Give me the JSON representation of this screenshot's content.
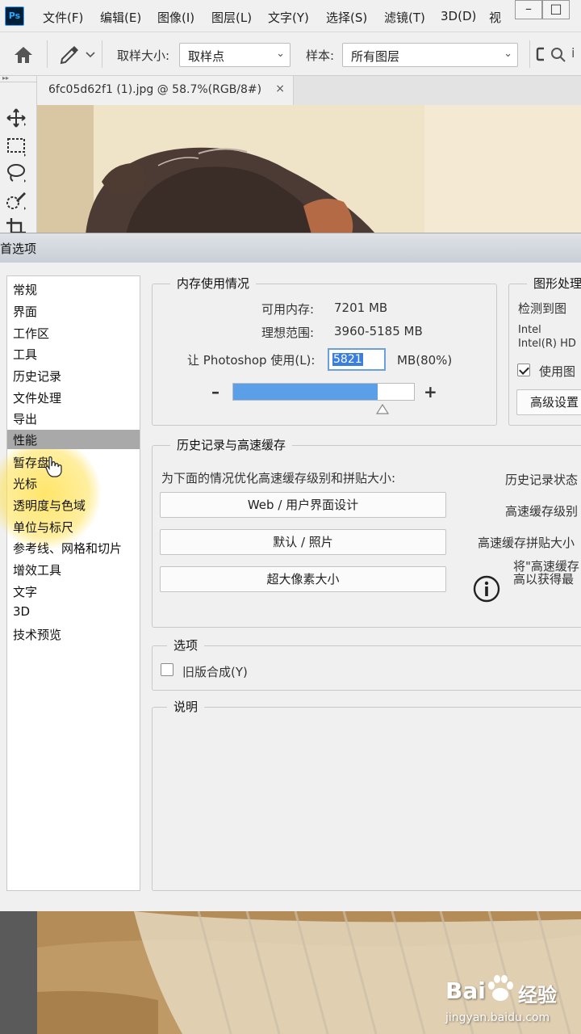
{
  "app": {
    "logo_text": "Ps"
  },
  "menu": [
    "文件(F)",
    "编辑(E)",
    "图像(I)",
    "图层(L)",
    "文字(Y)",
    "选择(S)",
    "滤镜(T)",
    "3D(D)",
    "视"
  ],
  "window_controls": {
    "minimize": "–",
    "maximize": "□"
  },
  "options_bar": {
    "sample_size_label": "取样大小:",
    "sample_size_value": "取样点",
    "sample_label": "样本:",
    "sample_value": "所有图层"
  },
  "document_tab": {
    "title": "6fc05d62f1 (1).jpg @ 58.7%(RGB/8#)",
    "close": "×"
  },
  "dialog": {
    "title": "首选项",
    "nav_items": [
      "常规",
      "界面",
      "工作区",
      "工具",
      "历史记录",
      "文件处理",
      "导出",
      "性能",
      "暂存盘",
      "光标",
      "透明度与色域",
      "单位与标尺",
      "参考线、网格和切片",
      "增效工具",
      "文字",
      "3D",
      "技术预览"
    ],
    "nav_selected_index": 7,
    "memory": {
      "title": "内存使用情况",
      "available_label": "可用内存:",
      "available_value": "7201 MB",
      "ideal_label": "理想范围:",
      "ideal_value": "3960-5185 MB",
      "use_label": "让 Photoshop 使用(L):",
      "use_value": "5821",
      "use_unit": "MB(80%)",
      "minus": "–",
      "plus": "+",
      "slider_percent": 80
    },
    "gpu": {
      "title": "图形处理",
      "detected": "检测到图",
      "vendor": "Intel",
      "model": "Intel(R) HD",
      "use_gpu_label": "使用图",
      "advanced_button": "高级设置"
    },
    "cache": {
      "title": "历史记录与高速缓存",
      "hint": "为下面的情况优化高速缓存级别和拼贴大小:",
      "buttons": [
        "Web / 用户界面设计",
        "默认 / 照片",
        "超大像素大小"
      ],
      "history_states_label": "历史记录状态",
      "cache_levels_label": "高速缓存级别",
      "tile_size_label": "高速缓存拼贴大小",
      "info_line1": "将\"高速缓存",
      "info_line2": "高以获得最"
    },
    "options": {
      "title": "选项",
      "legacy_compositing": "旧版合成(Y)"
    },
    "description": {
      "title": "说明"
    }
  },
  "watermark": {
    "brand": "Bai",
    "brand_cn": "经验",
    "url": "jingyan.baidu.com"
  }
}
